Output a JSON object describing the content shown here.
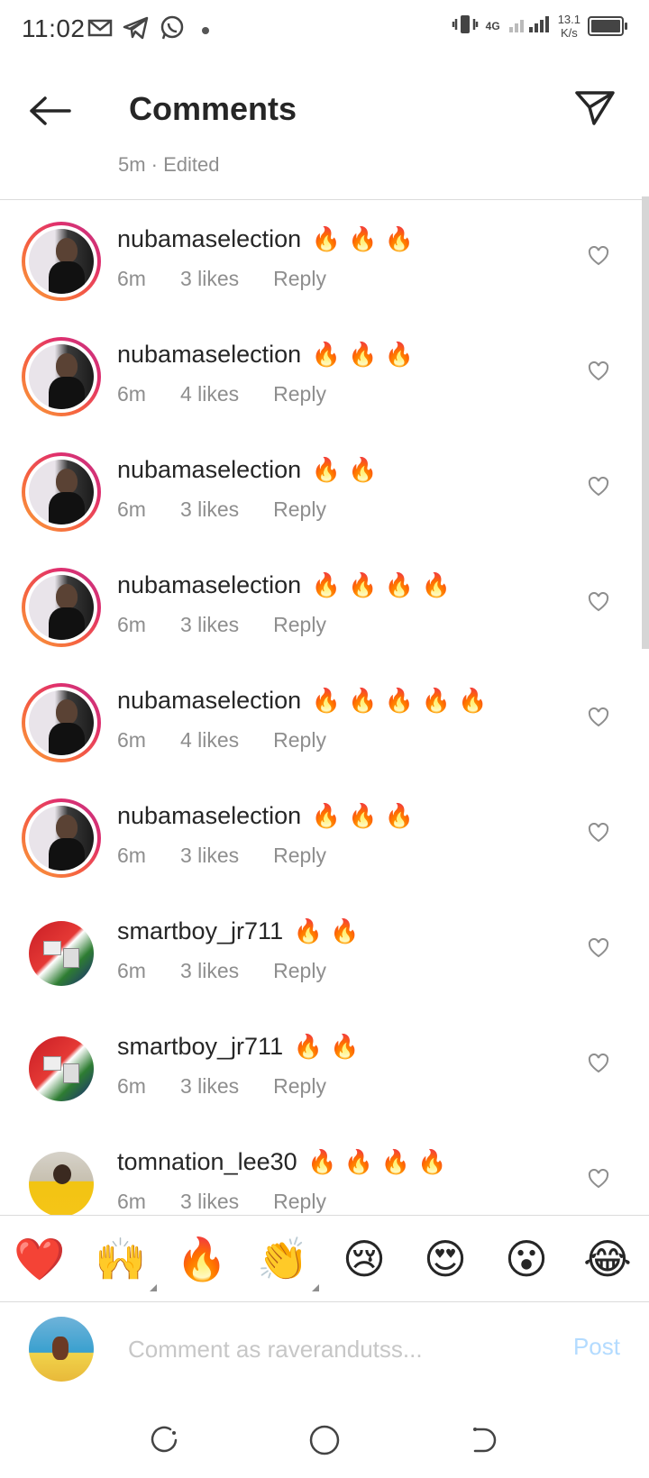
{
  "status_bar": {
    "time": "11:02",
    "network_type": "4G",
    "speed_value": "13.1",
    "speed_unit": "K/s",
    "icons": [
      "gmail-icon",
      "telegram-icon",
      "whatsapp-icon",
      "vibrate-icon",
      "signal-icon",
      "battery-icon"
    ]
  },
  "header": {
    "title": "Comments"
  },
  "caption_meta": "5m · Edited",
  "comments": [
    {
      "user": "nubamaselection",
      "emoji": "🔥 🔥 🔥",
      "time": "6m",
      "likes": "3 likes",
      "reply": "Reply"
    },
    {
      "user": "nubamaselection",
      "emoji": "🔥 🔥 🔥",
      "time": "6m",
      "likes": "4 likes",
      "reply": "Reply"
    },
    {
      "user": "nubamaselection",
      "emoji": "🔥 🔥",
      "time": "6m",
      "likes": "3 likes",
      "reply": "Reply"
    },
    {
      "user": "nubamaselection",
      "emoji": "🔥 🔥 🔥 🔥",
      "time": "6m",
      "likes": "3 likes",
      "reply": "Reply"
    },
    {
      "user": "nubamaselection",
      "emoji": "🔥 🔥 🔥 🔥 🔥",
      "time": "6m",
      "likes": "4 likes",
      "reply": "Reply"
    },
    {
      "user": "nubamaselection",
      "emoji": "🔥 🔥 🔥",
      "time": "6m",
      "likes": "3 likes",
      "reply": "Reply"
    },
    {
      "user": "smartboy_jr711",
      "emoji": "🔥 🔥",
      "time": "6m",
      "likes": "3 likes",
      "reply": "Reply"
    },
    {
      "user": "smartboy_jr711",
      "emoji": "🔥 🔥",
      "time": "6m",
      "likes": "3 likes",
      "reply": "Reply"
    },
    {
      "user": "tomnation_lee30",
      "emoji": "🔥 🔥 🔥 🔥",
      "time": "6m",
      "likes": "3 likes",
      "reply": "Reply"
    }
  ],
  "emoji_bar": [
    "❤️",
    "🙌",
    "🔥",
    "👏",
    "😢",
    "😍",
    "😮",
    "😂"
  ],
  "input": {
    "placeholder": "Comment as raverandutss...",
    "post_label": "Post"
  },
  "colors": {
    "accent": "#0095f6",
    "post_disabled": "#b3dbff",
    "heart": "#ed4956",
    "text": "#262626",
    "muted": "#8e8e8e"
  }
}
